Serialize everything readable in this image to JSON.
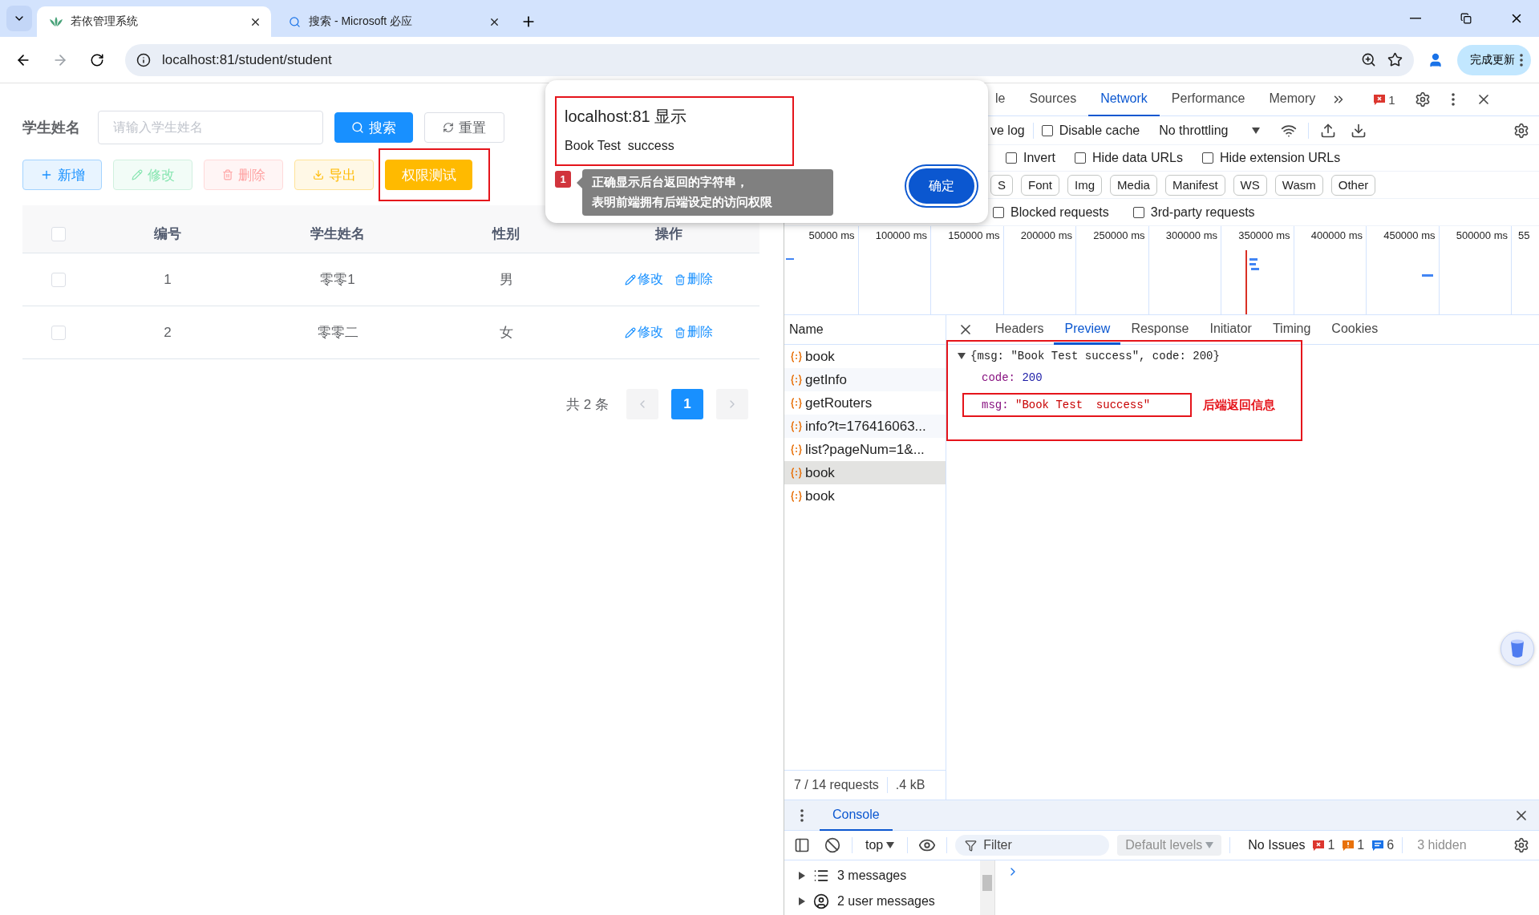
{
  "browser": {
    "tabs": [
      {
        "title": "若依管理系统",
        "selected": true,
        "kind": "app"
      },
      {
        "title": "搜索 - Microsoft 必应",
        "selected": false,
        "kind": "search"
      }
    ],
    "address": "localhost:81/student/student",
    "update_button": "完成更新"
  },
  "page": {
    "search": {
      "label": "学生姓名",
      "placeholder": "请输入学生姓名",
      "search_button": "搜索",
      "reset_button": "重置"
    },
    "toolbar": [
      {
        "label": "新增",
        "kind": "add",
        "disabled": false,
        "annotated": false
      },
      {
        "label": "修改",
        "kind": "edit",
        "disabled": true,
        "annotated": false
      },
      {
        "label": "删除",
        "kind": "delete",
        "disabled": true,
        "annotated": false
      },
      {
        "label": "导出",
        "kind": "export",
        "disabled": false,
        "annotated": false
      },
      {
        "label": "权限测试",
        "kind": "test",
        "disabled": false,
        "annotated": true
      }
    ],
    "table": {
      "header_checked": false,
      "columns": [
        "编号",
        "学生姓名",
        "性别",
        "操作"
      ],
      "rows": [
        {
          "checked": false,
          "cells": [
            "1",
            "零零1",
            "男"
          ],
          "actions": [
            "修改",
            "删除"
          ]
        },
        {
          "checked": false,
          "cells": [
            "2",
            "零零二",
            "女"
          ],
          "actions": [
            "修改",
            "删除"
          ]
        }
      ]
    },
    "pagination": {
      "total": "共 2 条",
      "pages": [
        {
          "label": "1",
          "selected": true
        }
      ]
    }
  },
  "dialog": {
    "origin": "localhost:81 显示",
    "message": "Book Test  success",
    "ok_button": "确定",
    "note": {
      "number": "1",
      "lines": [
        "正确显示后台返回的字符串，",
        "表明前端拥有后端设定的访问权限"
      ]
    }
  },
  "devtools": {
    "tabs": [
      {
        "label": "le",
        "selected": false
      },
      {
        "label": "Sources",
        "selected": false
      },
      {
        "label": "Network",
        "selected": true
      },
      {
        "label": "Performance",
        "selected": false
      },
      {
        "label": "Memory",
        "selected": false
      }
    ],
    "error_count": "1",
    "preserve_log": "ve log",
    "options": [
      {
        "label": "Disable cache",
        "checked": false
      }
    ],
    "throttling": "No throttling",
    "filters": [
      {
        "label": "Invert",
        "checked": false
      },
      {
        "label": "Hide data URLs",
        "checked": false
      },
      {
        "label": "Hide extension URLs",
        "checked": false
      }
    ],
    "types": [
      {
        "label": "S",
        "selected": false
      },
      {
        "label": "Font",
        "selected": false
      },
      {
        "label": "Img",
        "selected": false
      },
      {
        "label": "Media",
        "selected": false
      },
      {
        "label": "Manifest",
        "selected": false
      },
      {
        "label": "WS",
        "selected": false
      },
      {
        "label": "Wasm",
        "selected": false
      },
      {
        "label": "Other",
        "selected": false
      }
    ],
    "more_filters": [
      {
        "label": "Blocked requests",
        "checked": false
      },
      {
        "label": "3rd-party requests",
        "checked": false
      }
    ],
    "timeline_ticks": [
      "50000 ms",
      "100000 ms",
      "150000 ms",
      "200000 ms",
      "250000 ms",
      "300000 ms",
      "350000 ms",
      "400000 ms",
      "450000 ms",
      "500000 ms",
      "55"
    ],
    "name_header": "Name",
    "requests": [
      {
        "name": "book",
        "selected": false
      },
      {
        "name": "getInfo",
        "selected": false
      },
      {
        "name": "getRouters",
        "selected": false
      },
      {
        "name": "info?t=176416063...",
        "selected": false
      },
      {
        "name": "list?pageNum=1&...",
        "selected": false
      },
      {
        "name": "book",
        "selected": true
      },
      {
        "name": "book",
        "selected": false
      }
    ],
    "detail_tabs": [
      {
        "label": "Headers",
        "selected": false
      },
      {
        "label": "Preview",
        "selected": true
      },
      {
        "label": "Response",
        "selected": false
      },
      {
        "label": "Initiator",
        "selected": false
      },
      {
        "label": "Timing",
        "selected": false
      },
      {
        "label": "Cookies",
        "selected": false
      }
    ],
    "preview": {
      "summary": "{msg: \"Book Test success\", code: 200}",
      "expanded": true,
      "note": "后端返回信息",
      "properties": [
        {
          "key": "code:",
          "value": "200",
          "kind": "number",
          "highlighted": false
        },
        {
          "key": "msg:",
          "value": "\"Book Test  success\"",
          "kind": "string",
          "highlighted": true
        }
      ]
    },
    "status": [
      "7 / 14 requests",
      ".4 kB"
    ],
    "console": {
      "tab": "Console",
      "context": "top",
      "filter_placeholder": "Filter",
      "levels": "Default levels",
      "issues": "No Issues",
      "counts": [
        {
          "kind": "error",
          "count": "1"
        },
        {
          "kind": "warning",
          "count": "1"
        },
        {
          "kind": "info",
          "count": "6"
        }
      ],
      "hidden": "3 hidden",
      "groups": [
        {
          "kind": "messages",
          "label": "3 messages"
        },
        {
          "kind": "user",
          "label": "2 user messages"
        }
      ]
    }
  }
}
